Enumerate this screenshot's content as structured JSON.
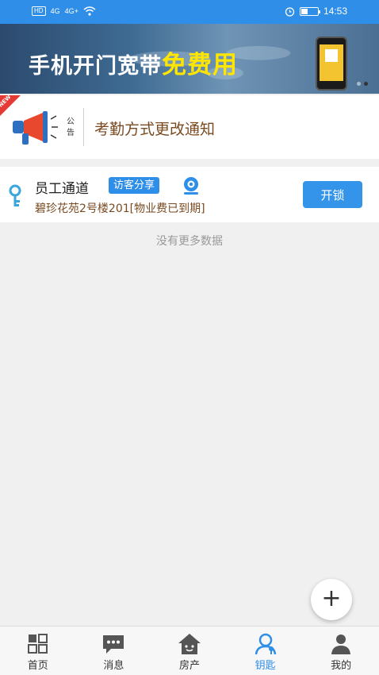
{
  "status_bar": {
    "hd": "HD",
    "signal1": "4G",
    "signal2": "4G+",
    "time": "14:53",
    "battery_level": 0.4
  },
  "banner": {
    "text_main": "手机开门宽带",
    "text_highlight": "免费用"
  },
  "notice": {
    "badge": "NEW",
    "tag": "公告",
    "title": "考勤方式更改通知"
  },
  "key_card": {
    "name": "员工通道",
    "visitor_share": "访客分享",
    "address": "碧珍花苑2号楼201[物业费已到期]",
    "unlock_label": "开锁"
  },
  "list_footer": "没有更多数据",
  "fab_label": "+",
  "bottom_nav": {
    "items": [
      {
        "label": "首页",
        "icon": "grid-icon"
      },
      {
        "label": "消息",
        "icon": "message-icon"
      },
      {
        "label": "房产",
        "icon": "house-icon"
      },
      {
        "label": "钥匙",
        "icon": "key-person-icon",
        "active": true
      },
      {
        "label": "我的",
        "icon": "user-icon"
      }
    ]
  },
  "colors": {
    "primary": "#2f8ee8",
    "brown_text": "#7a4a20",
    "highlight": "#ffe600",
    "new_badge": "#e53935"
  }
}
